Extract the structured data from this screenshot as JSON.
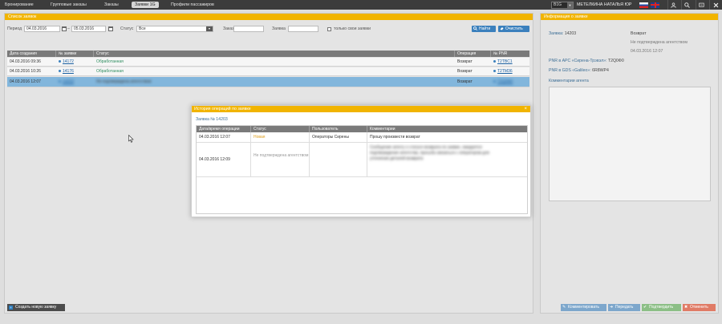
{
  "topnav": {
    "tabs": [
      "Бронирование",
      "Групповые заказы",
      "Заказы",
      "Заявки 1G",
      "Профили пассажиров"
    ],
    "agency": "B1G",
    "agency_arrow": "▼",
    "user": "МЕТЕЛКИНА НАТАЛЬЯ ЮР"
  },
  "list_panel": {
    "title": "Список заявок",
    "filters": {
      "period_label": "Период",
      "date_from": "04.03.2016",
      "separator": "–",
      "date_to": "05.03.2016",
      "status_label": "Статус",
      "status_value": "Все",
      "order_label": "Заказ",
      "request_label": "Заявка",
      "only_mine_label": "только свои заявки",
      "find_button": "Найти",
      "clear_button": "Очистить"
    },
    "columns": [
      "Дата создания",
      "№ заявки",
      "Статус",
      "Операция",
      "№ PNR"
    ],
    "rows": [
      {
        "date": "04.03.2016 09:36",
        "number": "14172",
        "status": "Обработанная",
        "operation": "Возврат",
        "pnr": "T2TBC1"
      },
      {
        "date": "04.03.2016 10:26",
        "number": "14176",
        "status": "Обработанная",
        "operation": "Возврат",
        "pnr": "T2TM36"
      },
      {
        "date": "04.03.2016 12:07",
        "number": "14203",
        "status": "Не подтверждена агентством",
        "operation": "Возврат",
        "pnr": "T2Q0Ф0"
      }
    ],
    "new_request_button": "Создать новую заявку"
  },
  "info_panel": {
    "title": "Информация о заявке",
    "request_label": "Заявка:",
    "request_number": "14203",
    "operation": "Возврат",
    "status": "Не подтверждена агентством",
    "datetime": "04.03.2016 12:07",
    "pnr_apc_label": "PNR в АРС «Сирена-Трэвэл»:",
    "pnr_apc_value": "T2Q0Ф0",
    "pnr_gds_label": "PNR в GDS «Galileo»:",
    "pnr_gds_value": "6R8WP4",
    "comment_label": "Комментарии агента",
    "buttons": {
      "comment": "Комментировать",
      "forward": "Передать",
      "confirm": "Подтвердить",
      "cancel": "Отменить"
    }
  },
  "modal": {
    "title": "История операций по заявке",
    "close": "×",
    "subtitle": "Заявка № 14203",
    "columns": [
      "Дата/время операции",
      "Статус",
      "Пользователь",
      "Комментарии"
    ],
    "rows": [
      {
        "datetime": "04.03.2016 12:07",
        "status": "Новая",
        "user": "Операторы Сирены",
        "comment": "Прошу произвести возврат"
      },
      {
        "datetime": "04.03.2016 12:09",
        "status": "Не подтверждена агентством",
        "user": "",
        "comment": "Сообщение агенту о статусе возврата по заявке, ожидается подтверждение агентства, просьба связаться с оператором для уточнения деталей возврата"
      }
    ]
  },
  "colors": {
    "accent": "#f1b400",
    "button_blue": "#3b80bd",
    "selected_row": "#82b6dc",
    "status_new": "#e0a020"
  }
}
